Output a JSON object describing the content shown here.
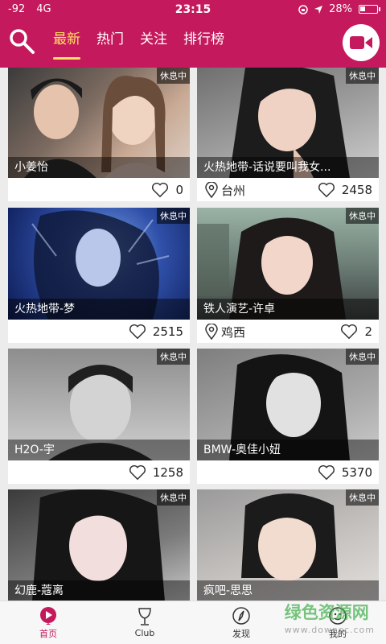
{
  "status_bar": {
    "signal": "-92",
    "network": "4G",
    "time": "23:15",
    "battery": "28%"
  },
  "header": {
    "tabs": [
      {
        "label": "最新",
        "active": true
      },
      {
        "label": "热门",
        "active": false
      },
      {
        "label": "关注",
        "active": false
      },
      {
        "label": "排行榜",
        "active": false
      }
    ],
    "accent_color": "#c4195c",
    "active_tab_color": "#ffe163"
  },
  "cards": [
    {
      "name": "小姜怡",
      "status": "休息中",
      "location": "",
      "likes": "0"
    },
    {
      "name": "火热地带-话说要叫我女...",
      "status": "休息中",
      "location": "台州",
      "likes": "2458"
    },
    {
      "name": "火热地带-梦",
      "status": "休息中",
      "location": "",
      "likes": "2515"
    },
    {
      "name": "铁人演艺-许卓",
      "status": "休息中",
      "location": "鸡西",
      "likes": "2"
    },
    {
      "name": "H2O-宇",
      "status": "休息中",
      "location": "",
      "likes": "1258"
    },
    {
      "name": "BMW-奥佳小妞",
      "status": "休息中",
      "location": "",
      "likes": "5370"
    },
    {
      "name": "幻鹿-蔻离",
      "status": "休息中",
      "location": "",
      "likes": ""
    },
    {
      "name": "疯吧-思思",
      "status": "休息中",
      "location": "",
      "likes": ""
    }
  ],
  "bottom_nav": [
    {
      "label": "首页",
      "icon": "home-play-icon",
      "active": true
    },
    {
      "label": "Club",
      "icon": "wine-glass-icon",
      "active": false
    },
    {
      "label": "发现",
      "icon": "compass-icon",
      "active": false
    },
    {
      "label": "我的",
      "icon": "profile-icon",
      "active": false
    }
  ],
  "watermark": {
    "title": "绿色资源网",
    "url": "www.downcc.com"
  }
}
